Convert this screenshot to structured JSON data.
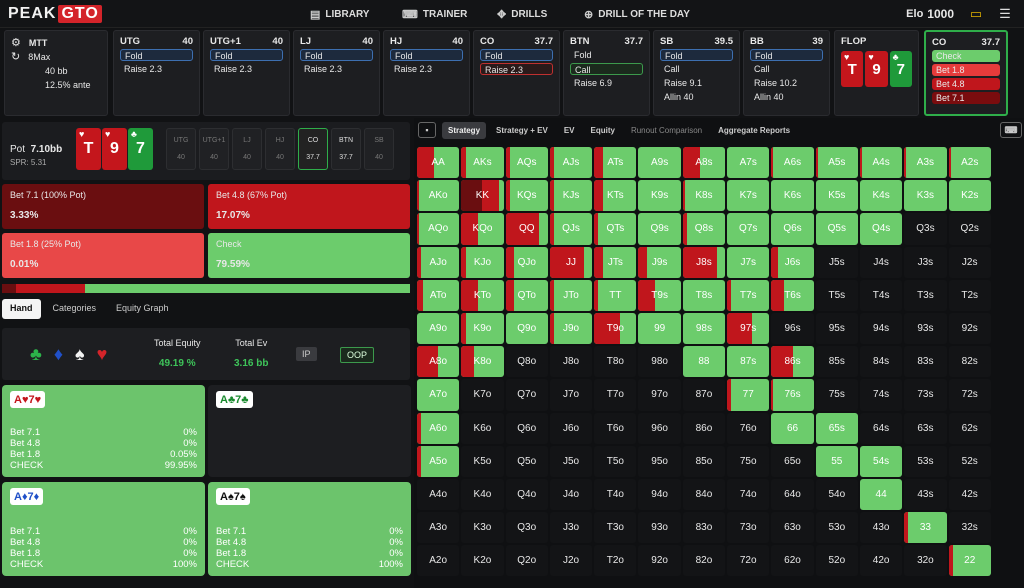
{
  "logo": {
    "peak": "PEAK",
    "gto": "GTO"
  },
  "nav": [
    {
      "icon": "library-icon",
      "glyph": "▤",
      "label": "LIBRARY"
    },
    {
      "icon": "trainer-icon",
      "glyph": "⌨",
      "label": "TRAINER"
    },
    {
      "icon": "drills-icon",
      "glyph": "✥",
      "label": "DRILLS"
    },
    {
      "icon": "drill-of-the-day-icon",
      "glyph": "⊕",
      "label": "DRILL OF THE DAY"
    }
  ],
  "elo": {
    "label": "Elo",
    "value": "1000"
  },
  "colors": {
    "raise": "#c0161c",
    "call": "#6ccc6c",
    "bet_big": "#6a0e10"
  },
  "game": {
    "format": "MTT",
    "table": "8Max",
    "stack": "40 bb",
    "ante": "12.5% ante"
  },
  "positions": [
    {
      "name": "UTG",
      "stack": "40",
      "actions": [
        {
          "label": "Fold",
          "state": "sel"
        },
        {
          "label": "Raise 2.3",
          "state": ""
        }
      ]
    },
    {
      "name": "UTG+1",
      "stack": "40",
      "actions": [
        {
          "label": "Fold",
          "state": "sel"
        },
        {
          "label": "Raise 2.3",
          "state": ""
        }
      ]
    },
    {
      "name": "LJ",
      "stack": "40",
      "actions": [
        {
          "label": "Fold",
          "state": "sel"
        },
        {
          "label": "Raise 2.3",
          "state": ""
        }
      ]
    },
    {
      "name": "HJ",
      "stack": "40",
      "actions": [
        {
          "label": "Fold",
          "state": "sel"
        },
        {
          "label": "Raise 2.3",
          "state": ""
        }
      ]
    },
    {
      "name": "CO",
      "stack": "37.7",
      "actions": [
        {
          "label": "Fold",
          "state": "sel"
        },
        {
          "label": "Raise 2.3",
          "state": "sel-red"
        }
      ]
    },
    {
      "name": "BTN",
      "stack": "37.7",
      "actions": [
        {
          "label": "Fold",
          "state": ""
        },
        {
          "label": "Call",
          "state": "sel-green"
        },
        {
          "label": "Raise 6.9",
          "state": ""
        }
      ]
    },
    {
      "name": "SB",
      "stack": "39.5",
      "actions": [
        {
          "label": "Fold",
          "state": "sel"
        },
        {
          "label": "Call",
          "state": ""
        },
        {
          "label": "Raise 9.1",
          "state": ""
        },
        {
          "label": "Allin 40",
          "state": ""
        }
      ]
    },
    {
      "name": "BB",
      "stack": "39",
      "actions": [
        {
          "label": "Fold",
          "state": "sel"
        },
        {
          "label": "Call",
          "state": ""
        },
        {
          "label": "Raise 10.2",
          "state": ""
        },
        {
          "label": "Allin 40",
          "state": ""
        }
      ]
    }
  ],
  "flop": {
    "label": "FLOP",
    "cards": [
      {
        "rank": "T",
        "suit": "♥",
        "color": "#c4161c"
      },
      {
        "rank": "9",
        "suit": "♥",
        "color": "#c4161c"
      },
      {
        "rank": "7",
        "suit": "♣",
        "color": "#1f9a3a"
      }
    ]
  },
  "co_box": {
    "name": "CO",
    "stack": "37.7",
    "actions": [
      {
        "label": "Check",
        "color": "#6ccc6c"
      },
      {
        "label": "Bet 1.8",
        "color": "#e63b3b"
      },
      {
        "label": "Bet 4.8",
        "color": "#c0161c"
      },
      {
        "label": "Bet 7.1",
        "color": "#7a0c0e"
      }
    ]
  },
  "pot": {
    "label": "Pot",
    "value": "7.10bb",
    "spr": "SPR: 5.31"
  },
  "seats": [
    {
      "n": "UTG",
      "s": "40"
    },
    {
      "n": "UTG+1",
      "s": "40"
    },
    {
      "n": "LJ",
      "s": "40"
    },
    {
      "n": "HJ",
      "s": "40"
    },
    {
      "n": "CO",
      "s": "37.7"
    },
    {
      "n": "BTN",
      "s": "37.7"
    },
    {
      "n": "SB",
      "s": "40"
    }
  ],
  "bets": [
    {
      "label": "Bet 7.1 (100% Pot)",
      "pct": "3.33%",
      "bg": "#6a0e10"
    },
    {
      "label": "Bet 4.8 (67% Pot)",
      "pct": "17.07%",
      "bg": "#c0161c"
    },
    {
      "label": "Bet 1.8 (25% Pot)",
      "pct": "0.01%",
      "bg": "#e84848"
    },
    {
      "label": "Check",
      "pct": "79.59%",
      "bg": "#6ccc6c"
    }
  ],
  "freq": [
    3.33,
    17.07,
    0.01,
    79.59
  ],
  "tabs": [
    "Hand",
    "Categories",
    "Equity Graph"
  ],
  "equity": {
    "total_equity_label": "Total Equity",
    "total_equity": "49.19 %",
    "total_ev_label": "Total Ev",
    "total_ev": "3.16 bb",
    "ip": "IP",
    "oop": "OOP"
  },
  "hands": [
    {
      "badge": "A♥7♥",
      "cls": "",
      "dark": false,
      "rows": [
        [
          "Bet 7.1",
          "0%"
        ],
        [
          "Bet 4.8",
          "0%"
        ],
        [
          "Bet 1.8",
          "0.05%"
        ],
        [
          "CHECK",
          "99.95%"
        ]
      ]
    },
    {
      "badge": "A♣7♣",
      "cls": "blk",
      "dark": true,
      "rows": []
    },
    {
      "badge": "A♦7♦",
      "cls": "blue",
      "dark": false,
      "rows": [
        [
          "Bet 7.1",
          "0%"
        ],
        [
          "Bet 4.8",
          "0%"
        ],
        [
          "Bet 1.8",
          "0%"
        ],
        [
          "CHECK",
          "100%"
        ]
      ]
    },
    {
      "badge": "A♠7♠",
      "cls": "dk",
      "dark": false,
      "rows": [
        [
          "Bet 7.1",
          "0%"
        ],
        [
          "Bet 4.8",
          "0%"
        ],
        [
          "Bet 1.8",
          "0%"
        ],
        [
          "CHECK",
          "100%"
        ]
      ]
    }
  ],
  "matrix_tabs": [
    {
      "label": "Strategy",
      "cls": "on"
    },
    {
      "label": "Strategy + EV",
      "cls": ""
    },
    {
      "label": "EV",
      "cls": ""
    },
    {
      "label": "Equity",
      "cls": ""
    },
    {
      "label": "Runout Comparison",
      "cls": "dim"
    },
    {
      "label": "Aggregate Reports",
      "cls": ""
    }
  ],
  "grid": [
    [
      [
        "AA",
        0.4,
        0
      ],
      [
        "AKs",
        0.1,
        0
      ],
      [
        "AQs",
        0.1,
        0
      ],
      [
        "AJs",
        0.1,
        0
      ],
      [
        "ATs",
        0.2,
        0
      ],
      [
        "A9s",
        0,
        0
      ],
      [
        "A8s",
        0.4,
        0
      ],
      [
        "A7s",
        0,
        0
      ],
      [
        "A6s",
        0.05,
        0
      ],
      [
        "A5s",
        0.05,
        0
      ],
      [
        "A4s",
        0.05,
        0
      ],
      [
        "A3s",
        0.05,
        0
      ],
      [
        "A2s",
        0.05,
        0
      ]
    ],
    [
      [
        "AKo",
        0.05,
        0
      ],
      [
        "KK",
        0.9,
        0.5
      ],
      [
        "KQs",
        0.1,
        0
      ],
      [
        "KJs",
        0.1,
        0
      ],
      [
        "KTs",
        0.2,
        0
      ],
      [
        "K9s",
        0,
        0
      ],
      [
        "K8s",
        0.05,
        0
      ],
      [
        "K7s",
        0,
        0
      ],
      [
        "K6s",
        0,
        0
      ],
      [
        "K5s",
        0,
        0
      ],
      [
        "K4s",
        0,
        0
      ],
      [
        "K3s",
        0,
        0
      ],
      [
        "K2s",
        0,
        0
      ]
    ],
    [
      [
        "AQo",
        0.05,
        0
      ],
      [
        "KQo",
        0.4,
        0
      ],
      [
        "QQ",
        0.8,
        0
      ],
      [
        "QJs",
        0.1,
        0
      ],
      [
        "QTs",
        0.1,
        0
      ],
      [
        "Q9s",
        0,
        0
      ],
      [
        "Q8s",
        0.1,
        0
      ],
      [
        "Q7s",
        0,
        0
      ],
      [
        "Q6s",
        0,
        0
      ],
      [
        "Q5s",
        0,
        0
      ],
      [
        "Q4s",
        0,
        0
      ],
      [
        "Q3s",
        -1,
        0
      ],
      [
        "Q2s",
        -1,
        0
      ]
    ],
    [
      [
        "AJo",
        0.1,
        0
      ],
      [
        "KJo",
        0.1,
        0
      ],
      [
        "QJo",
        0.2,
        0
      ],
      [
        "JJ",
        0.8,
        0
      ],
      [
        "JTs",
        0.2,
        0
      ],
      [
        "J9s",
        0.2,
        0
      ],
      [
        "J8s",
        0.8,
        0
      ],
      [
        "J7s",
        0,
        0
      ],
      [
        "J6s",
        0.15,
        0
      ],
      [
        "J5s",
        -1,
        0
      ],
      [
        "J4s",
        -1,
        0
      ],
      [
        "J3s",
        -1,
        0
      ],
      [
        "J2s",
        -1,
        0
      ]
    ],
    [
      [
        "ATo",
        0.15,
        0
      ],
      [
        "KTo",
        0.4,
        0
      ],
      [
        "QTo",
        0.2,
        0
      ],
      [
        "JTo",
        0.1,
        0
      ],
      [
        "TT",
        0.1,
        0
      ],
      [
        "T9s",
        0.4,
        0
      ],
      [
        "T8s",
        0,
        0
      ],
      [
        "T7s",
        0.1,
        0
      ],
      [
        "T6s",
        0.3,
        0
      ],
      [
        "T5s",
        -1,
        0
      ],
      [
        "T4s",
        -1,
        0
      ],
      [
        "T3s",
        -1,
        0
      ],
      [
        "T2s",
        -1,
        0
      ]
    ],
    [
      [
        "A9o",
        0,
        0
      ],
      [
        "K9o",
        0.1,
        0
      ],
      [
        "Q9o",
        0,
        0
      ],
      [
        "J9o",
        0.1,
        0
      ],
      [
        "T9o",
        0.6,
        0
      ],
      [
        "99",
        0,
        0
      ],
      [
        "98s",
        0,
        0
      ],
      [
        "97s",
        0.6,
        0
      ],
      [
        "96s",
        -1,
        0
      ],
      [
        "95s",
        -1,
        0
      ],
      [
        "94s",
        -1,
        0
      ],
      [
        "93s",
        -1,
        0
      ],
      [
        "92s",
        -1,
        0
      ]
    ],
    [
      [
        "A8o",
        0.5,
        0
      ],
      [
        "K8o",
        0.3,
        0
      ],
      [
        "Q8o",
        -1,
        0
      ],
      [
        "J8o",
        -1,
        0
      ],
      [
        "T8o",
        -1,
        0
      ],
      [
        "98o",
        -1,
        0
      ],
      [
        "88",
        0,
        0
      ],
      [
        "87s",
        0,
        0
      ],
      [
        "86s",
        0.5,
        0
      ],
      [
        "85s",
        -1,
        0
      ],
      [
        "84s",
        -1,
        0
      ],
      [
        "83s",
        -1,
        0
      ],
      [
        "82s",
        -1,
        0
      ]
    ],
    [
      [
        "A7o",
        0,
        0
      ],
      [
        "K7o",
        -1,
        0
      ],
      [
        "Q7o",
        -1,
        0
      ],
      [
        "J7o",
        -1,
        0
      ],
      [
        "T7o",
        -1,
        0
      ],
      [
        "97o",
        -1,
        0
      ],
      [
        "87o",
        -1,
        0
      ],
      [
        "77",
        0.1,
        0
      ],
      [
        "76s",
        0.05,
        0
      ],
      [
        "75s",
        -1,
        0
      ],
      [
        "74s",
        -1,
        0
      ],
      [
        "73s",
        -1,
        0
      ],
      [
        "72s",
        -1,
        0
      ]
    ],
    [
      [
        "A6o",
        0.1,
        0
      ],
      [
        "K6o",
        -1,
        0
      ],
      [
        "Q6o",
        -1,
        0
      ],
      [
        "J6o",
        -1,
        0
      ],
      [
        "T6o",
        -1,
        0
      ],
      [
        "96o",
        -1,
        0
      ],
      [
        "86o",
        -1,
        0
      ],
      [
        "76o",
        -1,
        0
      ],
      [
        "66",
        0,
        0
      ],
      [
        "65s",
        0,
        0
      ],
      [
        "64s",
        -1,
        0
      ],
      [
        "63s",
        -1,
        0
      ],
      [
        "62s",
        -1,
        0
      ]
    ],
    [
      [
        "A5o",
        0.1,
        0
      ],
      [
        "K5o",
        -1,
        0
      ],
      [
        "Q5o",
        -1,
        0
      ],
      [
        "J5o",
        -1,
        0
      ],
      [
        "T5o",
        -1,
        0
      ],
      [
        "95o",
        -1,
        0
      ],
      [
        "85o",
        -1,
        0
      ],
      [
        "75o",
        -1,
        0
      ],
      [
        "65o",
        -1,
        0
      ],
      [
        "55",
        0,
        0
      ],
      [
        "54s",
        0,
        0
      ],
      [
        "53s",
        -1,
        0
      ],
      [
        "52s",
        -1,
        0
      ]
    ],
    [
      [
        "A4o",
        -1,
        0
      ],
      [
        "K4o",
        -1,
        0
      ],
      [
        "Q4o",
        -1,
        0
      ],
      [
        "J4o",
        -1,
        0
      ],
      [
        "T4o",
        -1,
        0
      ],
      [
        "94o",
        -1,
        0
      ],
      [
        "84o",
        -1,
        0
      ],
      [
        "74o",
        -1,
        0
      ],
      [
        "64o",
        -1,
        0
      ],
      [
        "54o",
        -1,
        0
      ],
      [
        "44",
        0,
        0
      ],
      [
        "43s",
        -1,
        0
      ],
      [
        "42s",
        -1,
        0
      ]
    ],
    [
      [
        "A3o",
        -1,
        0
      ],
      [
        "K3o",
        -1,
        0
      ],
      [
        "Q3o",
        -1,
        0
      ],
      [
        "J3o",
        -1,
        0
      ],
      [
        "T3o",
        -1,
        0
      ],
      [
        "93o",
        -1,
        0
      ],
      [
        "83o",
        -1,
        0
      ],
      [
        "73o",
        -1,
        0
      ],
      [
        "63o",
        -1,
        0
      ],
      [
        "53o",
        -1,
        0
      ],
      [
        "43o",
        -1,
        0
      ],
      [
        "33",
        0.1,
        0
      ],
      [
        "32s",
        -1,
        0
      ]
    ],
    [
      [
        "A2o",
        -1,
        0
      ],
      [
        "K2o",
        -1,
        0
      ],
      [
        "Q2o",
        -1,
        0
      ],
      [
        "J2o",
        -1,
        0
      ],
      [
        "T2o",
        -1,
        0
      ],
      [
        "92o",
        -1,
        0
      ],
      [
        "82o",
        -1,
        0
      ],
      [
        "72o",
        -1,
        0
      ],
      [
        "62o",
        -1,
        0
      ],
      [
        "52o",
        -1,
        0
      ],
      [
        "42o",
        -1,
        0
      ],
      [
        "32o",
        -1,
        0
      ],
      [
        "22",
        0.1,
        0
      ]
    ]
  ]
}
